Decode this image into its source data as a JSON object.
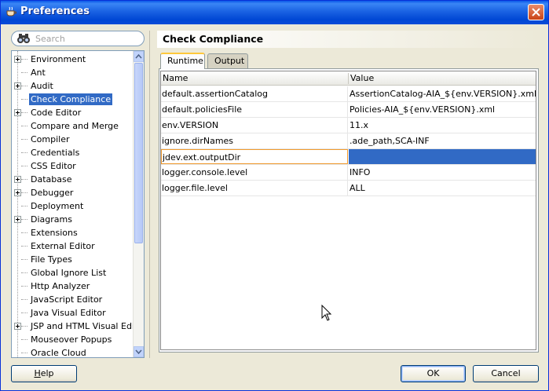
{
  "window": {
    "title": "Preferences",
    "icon": "coffee-cup-icon"
  },
  "search": {
    "placeholder": "Search"
  },
  "tree": {
    "items": [
      {
        "label": "Environment",
        "expandable": true
      },
      {
        "label": "Ant",
        "expandable": false
      },
      {
        "label": "Audit",
        "expandable": true
      },
      {
        "label": "Check Compliance",
        "expandable": false,
        "selected": true
      },
      {
        "label": "Code Editor",
        "expandable": true
      },
      {
        "label": "Compare and Merge",
        "expandable": false
      },
      {
        "label": "Compiler",
        "expandable": false
      },
      {
        "label": "Credentials",
        "expandable": false
      },
      {
        "label": "CSS Editor",
        "expandable": false
      },
      {
        "label": "Database",
        "expandable": true
      },
      {
        "label": "Debugger",
        "expandable": true
      },
      {
        "label": "Deployment",
        "expandable": false
      },
      {
        "label": "Diagrams",
        "expandable": true
      },
      {
        "label": "Extensions",
        "expandable": false
      },
      {
        "label": "External Editor",
        "expandable": false
      },
      {
        "label": "File Types",
        "expandable": false
      },
      {
        "label": "Global Ignore List",
        "expandable": false
      },
      {
        "label": "Http Analyzer",
        "expandable": false
      },
      {
        "label": "JavaScript Editor",
        "expandable": false
      },
      {
        "label": "Java Visual Editor",
        "expandable": false
      },
      {
        "label": "JSP and HTML Visual Editor",
        "expandable": true
      },
      {
        "label": "Mouseover Popups",
        "expandable": false
      },
      {
        "label": "Oracle Cloud",
        "expandable": false
      }
    ]
  },
  "panel": {
    "title": "Check Compliance"
  },
  "tabs": [
    {
      "label": "Runtime",
      "active": true
    },
    {
      "label": "Output",
      "active": false
    }
  ],
  "table": {
    "columns": [
      "Name",
      "Value"
    ],
    "rows": [
      {
        "name": "default.assertionCatalog",
        "value": "AssertionCatalog-AIA_${env.VERSION}.xml"
      },
      {
        "name": "default.policiesFile",
        "value": "Policies-AIA_${env.VERSION}.xml"
      },
      {
        "name": "env.VERSION",
        "value": "11.x"
      },
      {
        "name": "ignore.dirNames",
        "value": ".ade_path,SCA-INF"
      },
      {
        "name": "jdev.ext.outputDir",
        "value": "",
        "selected": true
      },
      {
        "name": "logger.console.level",
        "value": "INFO"
      },
      {
        "name": "logger.file.level",
        "value": "ALL"
      }
    ]
  },
  "buttons": {
    "help": "Help",
    "ok": "OK",
    "cancel": "Cancel"
  },
  "colors": {
    "titlebar": "#0a58e8",
    "selection": "#316ac5",
    "edit_border": "#f09a2e"
  }
}
